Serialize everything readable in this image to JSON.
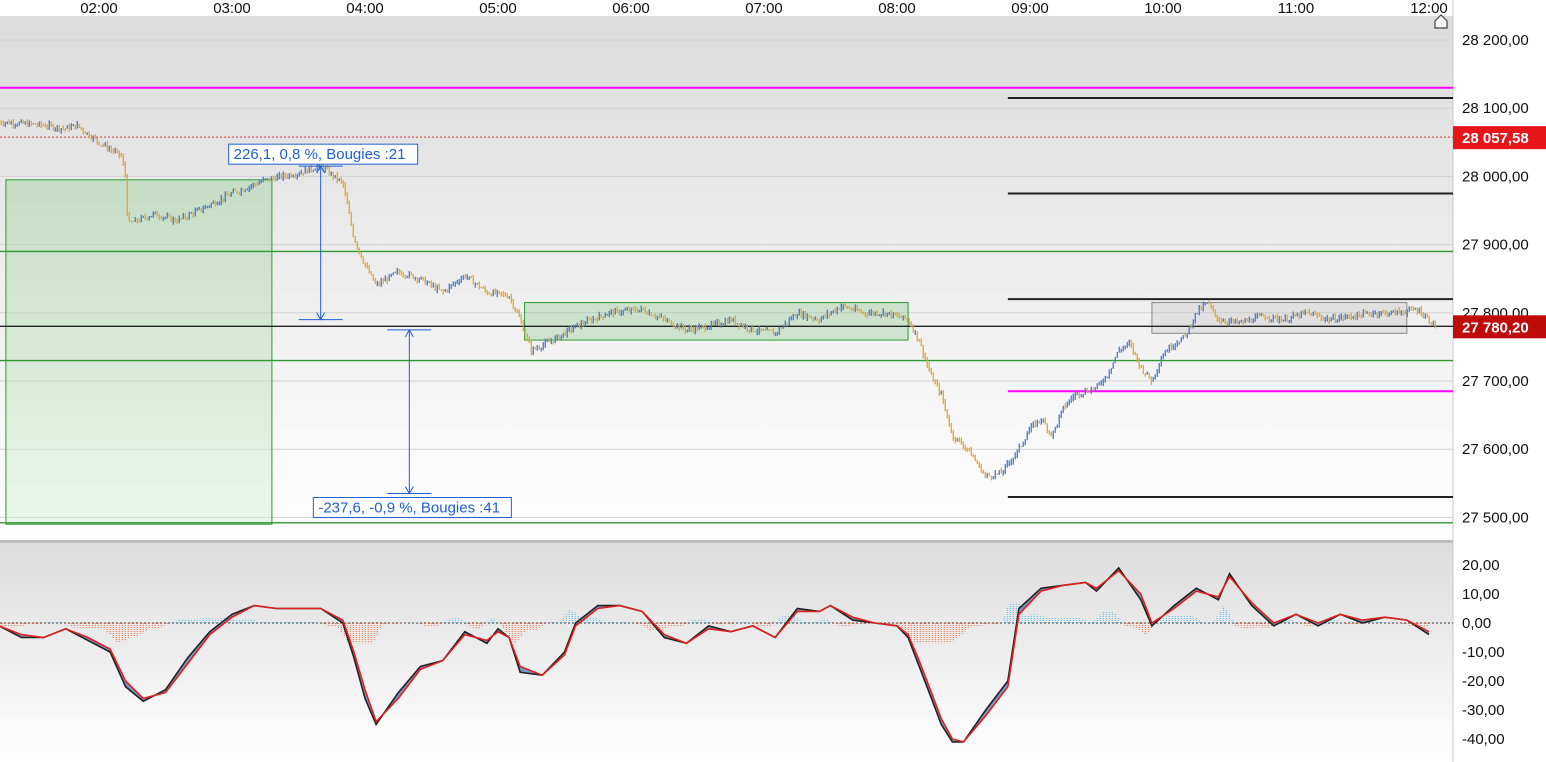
{
  "chart_data": [
    {
      "type": "candlestick",
      "x_ticks": [
        "02:00",
        "03:00",
        "04:00",
        "05:00",
        "06:00",
        "07:00",
        "08:00",
        "09:00",
        "10:00",
        "11:00",
        "12:00"
      ],
      "y_ticks": [
        "28 200,00",
        "28 100,00",
        "28 000,00",
        "27 900,00",
        "27 800,00",
        "27 700,00",
        "27 600,00",
        "27 500,00"
      ],
      "ylim": [
        27485,
        28240
      ],
      "price_path": [
        [
          "01:15",
          28080
        ],
        [
          "01:35",
          28075
        ],
        [
          "01:45",
          28070
        ],
        [
          "01:50",
          28075
        ],
        [
          "02:00",
          28050
        ],
        [
          "02:10",
          28030
        ],
        [
          "02:12",
          28000
        ],
        [
          "02:13",
          27930
        ],
        [
          "02:25",
          27945
        ],
        [
          "02:35",
          27935
        ],
        [
          "02:45",
          27950
        ],
        [
          "03:00",
          27975
        ],
        [
          "03:15",
          27995
        ],
        [
          "03:30",
          28005
        ],
        [
          "03:40",
          28015
        ],
        [
          "03:50",
          27990
        ],
        [
          "03:55",
          27910
        ],
        [
          "04:00",
          27870
        ],
        [
          "04:05",
          27840
        ],
        [
          "04:15",
          27860
        ],
        [
          "04:25",
          27850
        ],
        [
          "04:35",
          27830
        ],
        [
          "04:45",
          27855
        ],
        [
          "04:55",
          27830
        ],
        [
          "05:05",
          27825
        ],
        [
          "05:10",
          27790
        ],
        [
          "05:15",
          27745
        ],
        [
          "05:25",
          27760
        ],
        [
          "05:35",
          27780
        ],
        [
          "05:50",
          27800
        ],
        [
          "06:05",
          27805
        ],
        [
          "06:15",
          27790
        ],
        [
          "06:25",
          27775
        ],
        [
          "06:35",
          27780
        ],
        [
          "06:45",
          27790
        ],
        [
          "06:55",
          27775
        ],
        [
          "07:05",
          27770
        ],
        [
          "07:15",
          27800
        ],
        [
          "07:25",
          27790
        ],
        [
          "07:35",
          27810
        ],
        [
          "07:45",
          27800
        ],
        [
          "07:55",
          27800
        ],
        [
          "08:05",
          27790
        ],
        [
          "08:10",
          27760
        ],
        [
          "08:15",
          27710
        ],
        [
          "08:20",
          27680
        ],
        [
          "08:25",
          27620
        ],
        [
          "08:32",
          27600
        ],
        [
          "08:40",
          27560
        ],
        [
          "08:47",
          27565
        ],
        [
          "08:55",
          27600
        ],
        [
          "09:00",
          27630
        ],
        [
          "09:05",
          27645
        ],
        [
          "09:10",
          27620
        ],
        [
          "09:15",
          27660
        ],
        [
          "09:20",
          27680
        ],
        [
          "09:30",
          27690
        ],
        [
          "09:35",
          27710
        ],
        [
          "09:40",
          27745
        ],
        [
          "09:45",
          27755
        ],
        [
          "09:50",
          27720
        ],
        [
          "09:55",
          27700
        ],
        [
          "10:00",
          27740
        ],
        [
          "10:05",
          27755
        ],
        [
          "10:10",
          27765
        ],
        [
          "10:15",
          27800
        ],
        [
          "10:20",
          27815
        ],
        [
          "10:25",
          27790
        ],
        [
          "10:35",
          27785
        ],
        [
          "10:45",
          27795
        ],
        [
          "10:55",
          27790
        ],
        [
          "11:05",
          27800
        ],
        [
          "11:15",
          27790
        ],
        [
          "11:25",
          27795
        ],
        [
          "11:35",
          27800
        ],
        [
          "11:45",
          27800
        ],
        [
          "11:55",
          27805
        ],
        [
          "12:00",
          27790
        ],
        [
          "12:03",
          27780
        ]
      ],
      "horizontal_lines": [
        {
          "y": 28130,
          "color": "#ff00ff"
        },
        {
          "y": 28057.58,
          "color": "#e03030",
          "style": "dotted"
        },
        {
          "y": 27890,
          "color": "#2e9a2e"
        },
        {
          "y": 27780.2,
          "color": "#222222"
        },
        {
          "y": 27730,
          "color": "#2e9a2e"
        },
        {
          "y": 27492,
          "color": "#2e9a2e"
        }
      ],
      "level_lines": [
        {
          "y": 28115,
          "from": "08:50",
          "color": "#222222"
        },
        {
          "y": 27975,
          "from": "08:50",
          "color": "#222222"
        },
        {
          "y": 27820,
          "from": "08:50",
          "color": "#222222"
        },
        {
          "y": 27685,
          "from": "08:50",
          "color": "#ff00ff"
        },
        {
          "y": 27530,
          "from": "08:50",
          "color": "#222222"
        }
      ],
      "boxes": [
        {
          "from": "01:18",
          "to": "03:18",
          "top": 27995,
          "bottom": 27490,
          "color": "#2e9a2e"
        },
        {
          "from": "05:12",
          "to": "08:05",
          "top": 27815,
          "bottom": 27760,
          "color": "#2e9a2e"
        },
        {
          "from": "09:55",
          "to": "11:50",
          "top": 27815,
          "bottom": 27770,
          "color": "#888888"
        }
      ],
      "measures": [
        {
          "x": "03:40",
          "from": 28015,
          "to": 27790,
          "label": "226,1, 0,8 %, Bougies :21"
        },
        {
          "x": "04:20",
          "from": 27775,
          "to": 27535,
          "label": "-237,6, -0,9 %, Bougies :41"
        }
      ],
      "price_badges": [
        {
          "value": 28057.58,
          "label": "28 057,58",
          "color": "#e8151b"
        },
        {
          "value": 27780.2,
          "label": "27 780,20",
          "color": "#c00b0b"
        }
      ]
    },
    {
      "type": "line",
      "y_ticks": [
        "20,00",
        "10,00",
        "0,00",
        "-10,00",
        "-20,00",
        "-30,00",
        "-40,00"
      ],
      "ylim": [
        -44,
        22
      ],
      "series": [
        {
          "color": "#222222",
          "points": [
            [
              "01:15",
              -1
            ],
            [
              "01:25",
              -5
            ],
            [
              "01:35",
              -5
            ],
            [
              "01:45",
              -2
            ],
            [
              "01:55",
              -6
            ],
            [
              "02:05",
              -10
            ],
            [
              "02:12",
              -22
            ],
            [
              "02:20",
              -27
            ],
            [
              "02:30",
              -23
            ],
            [
              "02:40",
              -12
            ],
            [
              "02:50",
              -3
            ],
            [
              "03:00",
              3
            ],
            [
              "03:10",
              6
            ],
            [
              "03:20",
              5
            ],
            [
              "03:30",
              5
            ],
            [
              "03:40",
              5
            ],
            [
              "03:50",
              0
            ],
            [
              "03:55",
              -12
            ],
            [
              "04:00",
              -26
            ],
            [
              "04:05",
              -35
            ],
            [
              "04:15",
              -24
            ],
            [
              "04:25",
              -15
            ],
            [
              "04:35",
              -13
            ],
            [
              "04:45",
              -3
            ],
            [
              "04:55",
              -7
            ],
            [
              "05:00",
              -2
            ],
            [
              "05:05",
              -5
            ],
            [
              "05:10",
              -17
            ],
            [
              "05:20",
              -18
            ],
            [
              "05:30",
              -10
            ],
            [
              "05:35",
              0
            ],
            [
              "05:45",
              6
            ],
            [
              "05:55",
              6
            ],
            [
              "06:05",
              4
            ],
            [
              "06:15",
              -5
            ],
            [
              "06:25",
              -7
            ],
            [
              "06:35",
              -1
            ],
            [
              "06:45",
              -3
            ],
            [
              "06:55",
              -1
            ],
            [
              "07:05",
              -5
            ],
            [
              "07:15",
              5
            ],
            [
              "07:25",
              4
            ],
            [
              "07:30",
              6
            ],
            [
              "07:40",
              1
            ],
            [
              "07:50",
              0
            ],
            [
              "08:00",
              -1
            ],
            [
              "08:05",
              -5
            ],
            [
              "08:10",
              -15
            ],
            [
              "08:15",
              -25
            ],
            [
              "08:20",
              -35
            ],
            [
              "08:25",
              -41
            ],
            [
              "08:30",
              -41
            ],
            [
              "08:40",
              -30
            ],
            [
              "08:50",
              -20
            ],
            [
              "08:55",
              5
            ],
            [
              "09:05",
              12
            ],
            [
              "09:15",
              13
            ],
            [
              "09:25",
              14
            ],
            [
              "09:30",
              11
            ],
            [
              "09:40",
              19
            ],
            [
              "09:50",
              8
            ],
            [
              "09:55",
              -1
            ],
            [
              "10:05",
              6
            ],
            [
              "10:15",
              12
            ],
            [
              "10:25",
              8
            ],
            [
              "10:30",
              17
            ],
            [
              "10:40",
              6
            ],
            [
              "10:50",
              -1
            ],
            [
              "11:00",
              3
            ],
            [
              "11:10",
              -1
            ],
            [
              "11:20",
              3
            ],
            [
              "11:30",
              0
            ],
            [
              "11:40",
              2
            ],
            [
              "11:50",
              1
            ],
            [
              "12:00",
              -4
            ]
          ]
        },
        {
          "color": "#e02020",
          "points": [
            [
              "01:15",
              -1
            ],
            [
              "01:25",
              -4
            ],
            [
              "01:35",
              -5
            ],
            [
              "01:45",
              -2
            ],
            [
              "01:55",
              -5
            ],
            [
              "02:05",
              -9
            ],
            [
              "02:12",
              -20
            ],
            [
              "02:20",
              -26
            ],
            [
              "02:30",
              -24
            ],
            [
              "02:40",
              -14
            ],
            [
              "02:50",
              -4
            ],
            [
              "03:00",
              2
            ],
            [
              "03:10",
              6
            ],
            [
              "03:20",
              5
            ],
            [
              "03:30",
              5
            ],
            [
              "03:40",
              5
            ],
            [
              "03:50",
              1
            ],
            [
              "03:55",
              -10
            ],
            [
              "04:00",
              -23
            ],
            [
              "04:05",
              -34
            ],
            [
              "04:15",
              -26
            ],
            [
              "04:25",
              -16
            ],
            [
              "04:35",
              -13
            ],
            [
              "04:45",
              -4
            ],
            [
              "04:55",
              -6
            ],
            [
              "05:00",
              -3
            ],
            [
              "05:05",
              -5
            ],
            [
              "05:10",
              -15
            ],
            [
              "05:20",
              -18
            ],
            [
              "05:30",
              -11
            ],
            [
              "05:35",
              -1
            ],
            [
              "05:45",
              5
            ],
            [
              "05:55",
              6
            ],
            [
              "06:05",
              4
            ],
            [
              "06:15",
              -4
            ],
            [
              "06:25",
              -7
            ],
            [
              "06:35",
              -2
            ],
            [
              "06:45",
              -3
            ],
            [
              "06:55",
              -1
            ],
            [
              "07:05",
              -5
            ],
            [
              "07:15",
              4
            ],
            [
              "07:25",
              4
            ],
            [
              "07:30",
              6
            ],
            [
              "07:40",
              2
            ],
            [
              "07:50",
              0
            ],
            [
              "08:00",
              -1
            ],
            [
              "08:05",
              -4
            ],
            [
              "08:10",
              -13
            ],
            [
              "08:15",
              -23
            ],
            [
              "08:20",
              -33
            ],
            [
              "08:25",
              -40
            ],
            [
              "08:30",
              -41
            ],
            [
              "08:40",
              -32
            ],
            [
              "08:50",
              -22
            ],
            [
              "08:55",
              3
            ],
            [
              "09:05",
              11
            ],
            [
              "09:15",
              13
            ],
            [
              "09:25",
              14
            ],
            [
              "09:30",
              12
            ],
            [
              "09:40",
              18
            ],
            [
              "09:50",
              10
            ],
            [
              "09:55",
              0
            ],
            [
              "10:05",
              5
            ],
            [
              "10:15",
              11
            ],
            [
              "10:25",
              9
            ],
            [
              "10:30",
              16
            ],
            [
              "10:40",
              7
            ],
            [
              "10:50",
              0
            ],
            [
              "11:00",
              3
            ],
            [
              "11:10",
              0
            ],
            [
              "11:20",
              3
            ],
            [
              "11:30",
              1
            ],
            [
              "11:40",
              2
            ],
            [
              "11:50",
              1
            ],
            [
              "12:00",
              -3
            ]
          ]
        }
      ],
      "histogram_positive_color": "#4fb8e6",
      "histogram_negative_color": "#ef6a3a"
    }
  ]
}
